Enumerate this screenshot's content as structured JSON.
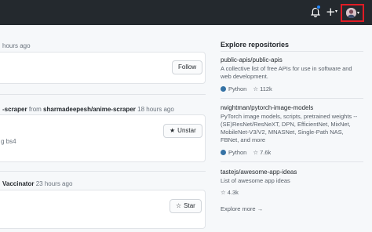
{
  "header": {
    "new_label": "+",
    "caret": "▾",
    "icons": [
      "bell-icon",
      "plus-icon",
      "avatar"
    ],
    "accent": "#2188ff",
    "highlight": "#e01b24"
  },
  "feed": {
    "item1": {
      "time": "hours ago",
      "button": "Follow"
    },
    "item2": {
      "repo": "-scraper",
      "connector": "from",
      "source": "sharmadeepesh/anime-scraper",
      "time": "18 hours ago",
      "desc": "g bs4",
      "button": "Unstar"
    },
    "item3": {
      "repo": "Vaccinator",
      "time": "23 hours ago",
      "button": "Star"
    }
  },
  "sidebar": {
    "title": "Explore repositories",
    "repos": [
      {
        "name": "public-apis/public-apis",
        "desc": "A collective list of free APIs for use in software and web development.",
        "language": "Python",
        "lang_color": "#3572A5",
        "stars": "112k"
      },
      {
        "name": "rwightman/pytorch-image-models",
        "desc": "PyTorch image models, scripts, pretrained weights -- (SE)ResNet/ResNeXT, DPN, EfficientNet, MixNet, MobileNet-V3/V2, MNASNet, Single-Path NAS, FBNet, and more",
        "language": "Python",
        "lang_color": "#3572A5",
        "stars": "7.6k"
      },
      {
        "name": "tastejs/awesome-app-ideas",
        "desc": "List of awesome app ideas",
        "stars": "4.3k"
      }
    ],
    "explore_more": "Explore more →"
  }
}
